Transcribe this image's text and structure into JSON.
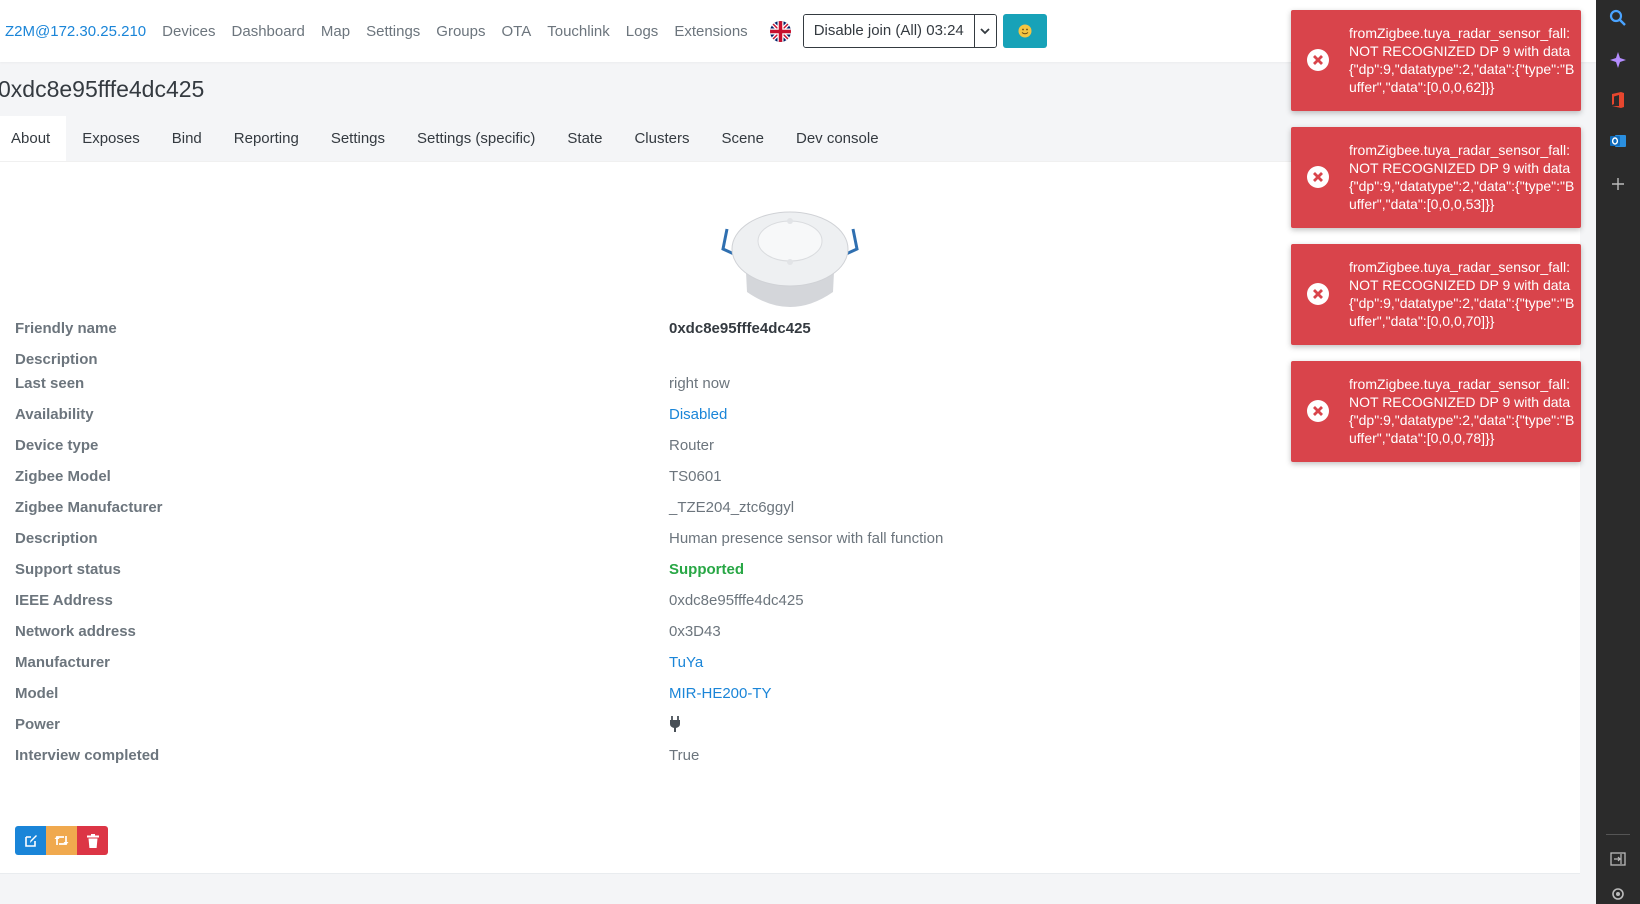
{
  "navbar": {
    "brand": "Z2M@172.30.25.210",
    "links": [
      "Devices",
      "Dashboard",
      "Map",
      "Settings",
      "Groups",
      "OTA",
      "Touchlink",
      "Logs",
      "Extensions"
    ],
    "join_button": "Disable join (All) 03:24",
    "flag_icon": "uk-flag-icon",
    "theme_icon": "smiley-icon"
  },
  "page": {
    "title": "0xdc8e95fffe4dc425",
    "tabs": [
      "About",
      "Exposes",
      "Bind",
      "Reporting",
      "Settings",
      "Settings (specific)",
      "State",
      "Clusters",
      "Scene",
      "Dev console"
    ],
    "active_tab": "About"
  },
  "details": [
    {
      "label": "Friendly name",
      "value": "0xdc8e95fffe4dc425",
      "style": "strong"
    },
    {
      "label": "Description",
      "value": ""
    },
    {
      "label": "Last seen",
      "value": "right now"
    },
    {
      "label": "Availability",
      "value": "Disabled",
      "style": "link"
    },
    {
      "label": "Device type",
      "value": "Router"
    },
    {
      "label": "Zigbee Model",
      "value": "TS0601"
    },
    {
      "label": "Zigbee Manufacturer",
      "value": "_TZE204_ztc6ggyl"
    },
    {
      "label": "Description",
      "value": "Human presence sensor with fall function"
    },
    {
      "label": "Support status",
      "value": "Supported",
      "style": "ok"
    },
    {
      "label": "IEEE Address",
      "value": "0xdc8e95fffe4dc425"
    },
    {
      "label": "Network address",
      "value": "0x3D43"
    },
    {
      "label": "Manufacturer",
      "value": "TuYa",
      "style": "link"
    },
    {
      "label": "Model",
      "value": "MIR-HE200-TY",
      "style": "link"
    },
    {
      "label": "Power",
      "value": "",
      "icon": "plug-icon"
    },
    {
      "label": "Interview completed",
      "value": "True"
    }
  ],
  "actions": [
    "edit-icon",
    "retweet-icon",
    "trash-icon"
  ],
  "toasts": [
    "fromZigbee.tuya_radar_sensor_fall: NOT RECOGNIZED DP 9 with data {\"dp\":9,\"datatype\":2,\"data\":{\"type\":\"Buffer\",\"data\":[0,0,0,62]}}",
    "fromZigbee.tuya_radar_sensor_fall: NOT RECOGNIZED DP 9 with data {\"dp\":9,\"datatype\":2,\"data\":{\"type\":\"Buffer\",\"data\":[0,0,0,53]}}",
    "fromZigbee.tuya_radar_sensor_fall: NOT RECOGNIZED DP 9 with data {\"dp\":9,\"datatype\":2,\"data\":{\"type\":\"Buffer\",\"data\":[0,0,0,70]}}",
    "fromZigbee.tuya_radar_sensor_fall: NOT RECOGNIZED DP 9 with data {\"dp\":9,\"datatype\":2,\"data\":{\"type\":\"Buffer\",\"data\":[0,0,0,78]}}"
  ],
  "colors": {
    "accent": "#1a85d8",
    "toast": "#d9444b",
    "success": "#28a745"
  }
}
